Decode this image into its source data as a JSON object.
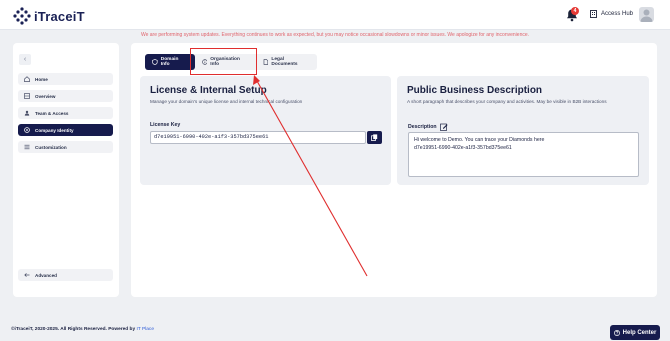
{
  "brand": {
    "name": "iTraceiT"
  },
  "header": {
    "notification_count": "4",
    "access_hub_label": "Access Hub"
  },
  "notice": "We are performing system updates. Everything continues to work as expected, but you may notice occasional slowdowns or minor issues. We apologize for any inconvenience.",
  "sidebar": {
    "items": [
      {
        "label": "Home"
      },
      {
        "label": "Overview"
      },
      {
        "label": "Team & Access"
      },
      {
        "label": "Company Identity"
      },
      {
        "label": "Customization"
      }
    ],
    "advanced_label": "Advanced"
  },
  "tabs": [
    {
      "label": "Domain Info"
    },
    {
      "label": "Organisation Info"
    },
    {
      "label": "Legal Documents"
    }
  ],
  "license_card": {
    "title": "License & Internal Setup",
    "subtitle": "Manage your domain's unique license and internal technical configuration",
    "key_label": "License Key",
    "key_value": "d7e19951-6990-402e-a1f3-357bd375ee61"
  },
  "description_card": {
    "title": "Public Business Description",
    "subtitle": "A short paragraph that describes your company and activities. May be visible in B2B interactions",
    "label": "Description",
    "line1": "Hi welcome to Demo. You can trace your Diamonds here",
    "line2": "d7e19951-6990-402e-a1f3-357bd375ee61"
  },
  "footer": {
    "copyright": "©iTraceiT, 2020-2025. All Rights Reserved. Powered by",
    "powered_by": "IT Place"
  },
  "help_center_label": "Help Center",
  "colors": {
    "primary": "#161b4d",
    "annotation_red": "#e02e2e",
    "notice": "#e0646c"
  }
}
